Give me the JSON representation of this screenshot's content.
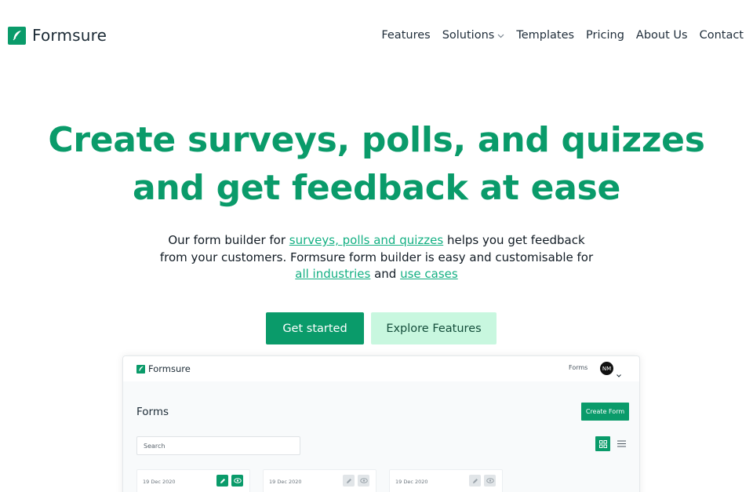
{
  "nav": {
    "brand": "Formsure",
    "items": [
      {
        "label": "Features",
        "has_dropdown": false
      },
      {
        "label": "Solutions",
        "has_dropdown": true
      },
      {
        "label": "Templates",
        "has_dropdown": false
      },
      {
        "label": "Pricing",
        "has_dropdown": false
      },
      {
        "label": "About Us",
        "has_dropdown": false
      },
      {
        "label": "Contact",
        "has_dropdown": false
      }
    ]
  },
  "hero": {
    "title_line1": "Create surveys, polls, and quizzes",
    "title_line2": "and get feedback at ease",
    "desc_part1": "Our form builder for ",
    "link_surveys": "surveys, polls and quizzes",
    "desc_part2": " helps you get feedback from your customers. Formsure form builder is easy and customisable for ",
    "link_industries": "all industries",
    "desc_part3": " and ",
    "link_use_cases": "use cases",
    "cta_primary": "Get started",
    "cta_secondary": "Explore Features"
  },
  "preview": {
    "brand": "Formsure",
    "forms_link": "Forms",
    "avatar_initials": "NM",
    "heading": "Forms",
    "create_button": "Create Form",
    "search_placeholder": "Search",
    "cards": [
      {
        "date": "19 Dec 2020",
        "active": true
      },
      {
        "date": "19 Dec 2020",
        "active": false
      },
      {
        "date": "19 Dec 2020",
        "active": false
      }
    ]
  },
  "colors": {
    "brand_green": "#0a9b6a",
    "link_green": "#14b083",
    "mint": "#c8f7df",
    "icons": [
      "feather-logo-icon",
      "chevron-down-icon",
      "edit-icon",
      "eye-icon",
      "grid-icon",
      "list-icon"
    ]
  }
}
